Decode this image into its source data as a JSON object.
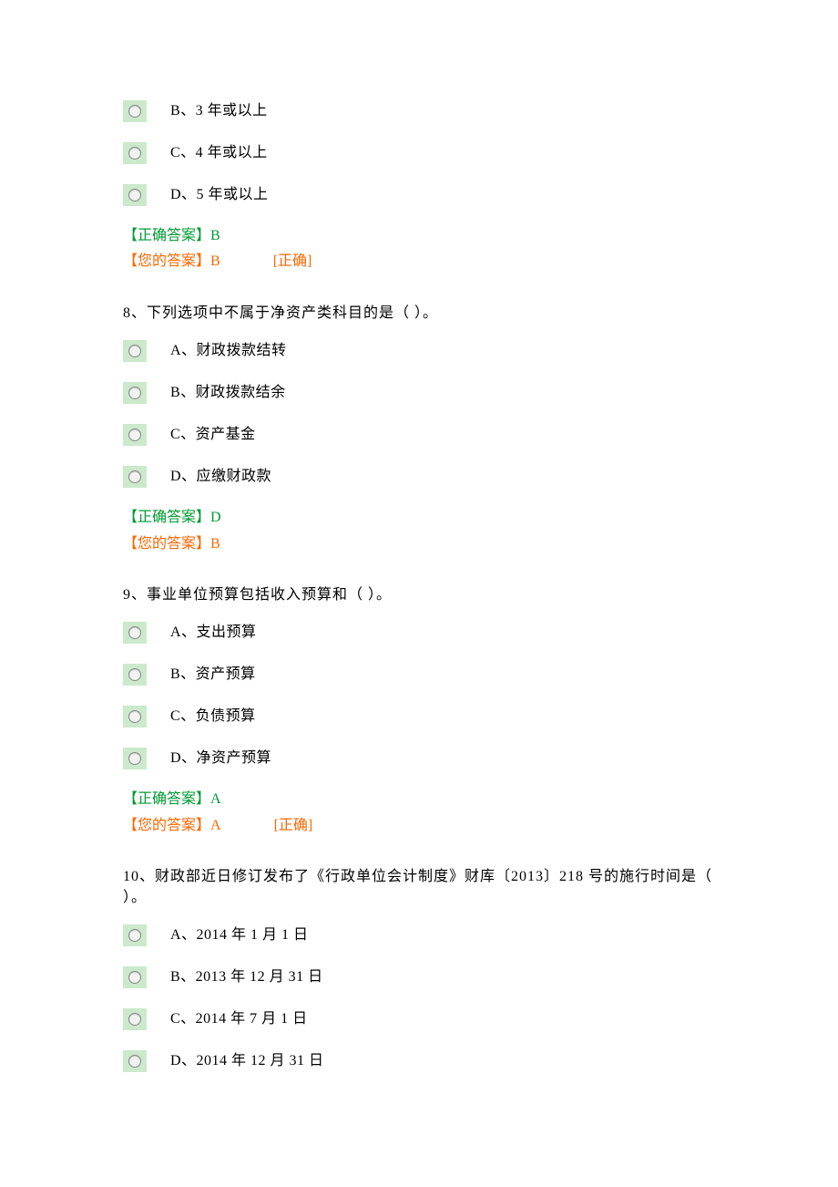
{
  "labels": {
    "correct_prefix": "【正确答案】",
    "your_prefix": "【您的答案】",
    "status_correct": "[正确]"
  },
  "q7": {
    "options": {
      "b": "B、3 年或以上",
      "c": "C、4 年或以上",
      "d": "D、5 年或以上"
    },
    "correct": "B",
    "your": "B",
    "your_status": "[正确]"
  },
  "q8": {
    "stem": "8、下列选项中不属于净资产类科目的是（   ）。",
    "options": {
      "a": "A、财政拨款结转",
      "b": "B、财政拨款结余",
      "c": "C、资产基金",
      "d": "D、应缴财政款"
    },
    "correct": "D",
    "your": "B",
    "your_status": ""
  },
  "q9": {
    "stem": "9、事业单位预算包括收入预算和（     ）。",
    "options": {
      "a": "A、支出预算",
      "b": "B、资产预算",
      "c": "C、负债预算",
      "d": "D、净资产预算"
    },
    "correct": "A",
    "your": "A",
    "your_status": "[正确]"
  },
  "q10": {
    "stem": "10、财政部近日修订发布了《行政单位会计制度》财库〔2013〕218 号的施行时间是（  ）。",
    "options": {
      "a": "A、2014 年 1 月 1 日",
      "b": "B、2013 年 12 月 31 日",
      "c": "C、2014 年 7 月 1 日",
      "d": "D、2014 年 12 月 31 日"
    }
  }
}
